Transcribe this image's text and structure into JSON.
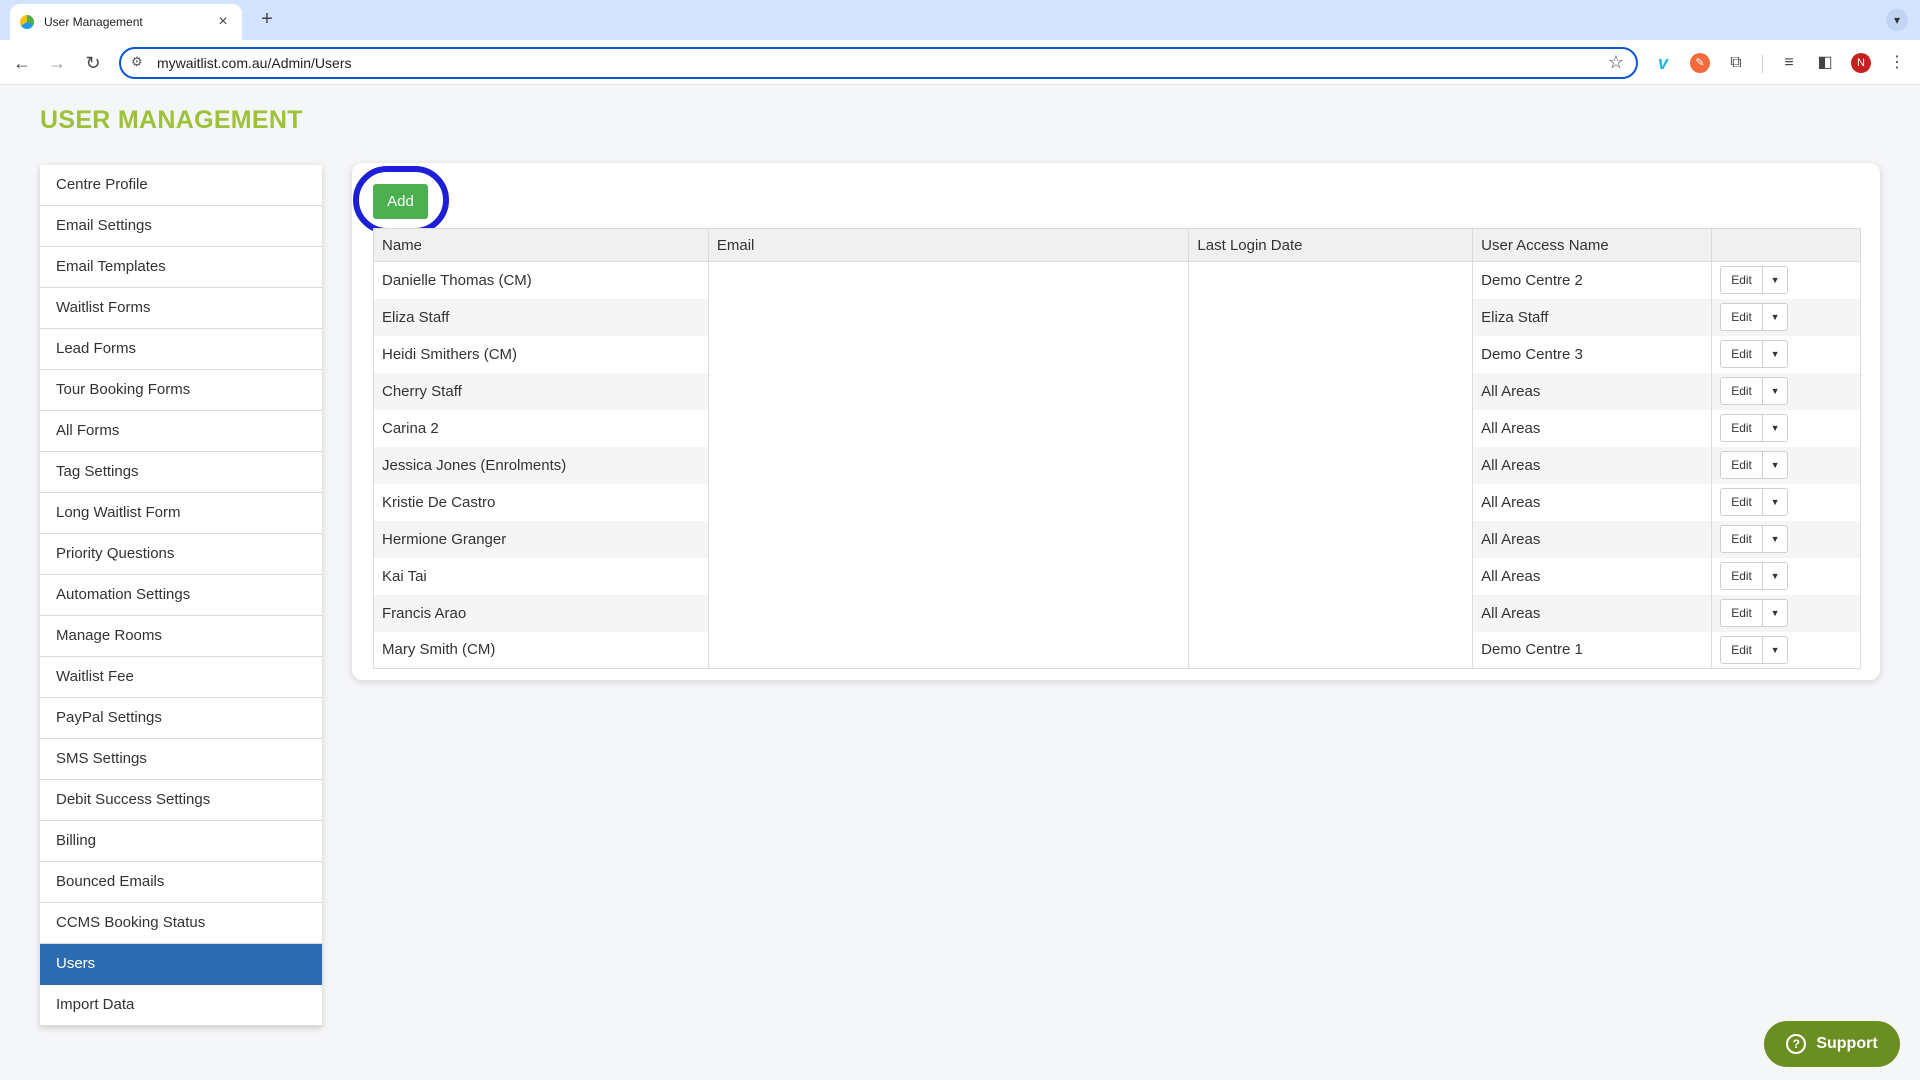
{
  "browser": {
    "tab_title": "User Management",
    "tab_close": "×",
    "new_tab": "+",
    "url": "mywaitlist.com.au/Admin/Users",
    "profile_initial": "N"
  },
  "page": {
    "title": "USER MANAGEMENT",
    "add_label": "Add",
    "support_label": "Support"
  },
  "sidebar": {
    "items": [
      {
        "label": "Centre Profile"
      },
      {
        "label": "Email Settings"
      },
      {
        "label": "Email Templates"
      },
      {
        "label": "Waitlist Forms"
      },
      {
        "label": "Lead Forms"
      },
      {
        "label": "Tour Booking Forms"
      },
      {
        "label": "All Forms"
      },
      {
        "label": "Tag Settings"
      },
      {
        "label": "Long Waitlist Form"
      },
      {
        "label": "Priority Questions"
      },
      {
        "label": "Automation Settings"
      },
      {
        "label": "Manage Rooms"
      },
      {
        "label": "Waitlist Fee"
      },
      {
        "label": "PayPal Settings"
      },
      {
        "label": "SMS Settings"
      },
      {
        "label": "Debit Success Settings"
      },
      {
        "label": "Billing"
      },
      {
        "label": "Bounced Emails"
      },
      {
        "label": "CCMS Booking Status"
      },
      {
        "label": "Users"
      },
      {
        "label": "Import Data"
      }
    ],
    "active_index": 19
  },
  "table": {
    "headers": [
      "Name",
      "Email",
      "Last Login Date",
      "User Access Name",
      ""
    ],
    "edit_label": "Edit",
    "rows": [
      {
        "name": "Danielle Thomas (CM)",
        "email": "",
        "last_login": "",
        "access": "Demo Centre 2"
      },
      {
        "name": "Eliza Staff",
        "email": "",
        "last_login": "",
        "access": "Eliza Staff"
      },
      {
        "name": "Heidi Smithers (CM)",
        "email": "",
        "last_login": "",
        "access": "Demo Centre 3"
      },
      {
        "name": "Cherry Staff",
        "email": "",
        "last_login": "",
        "access": "All Areas"
      },
      {
        "name": "Carina 2",
        "email": "",
        "last_login": "",
        "access": "All Areas"
      },
      {
        "name": "Jessica Jones (Enrolments)",
        "email": "",
        "last_login": "",
        "access": "All Areas"
      },
      {
        "name": "Kristie De Castro",
        "email": "",
        "last_login": "",
        "access": "All Areas"
      },
      {
        "name": "Hermione Granger",
        "email": "",
        "last_login": "",
        "access": "All Areas"
      },
      {
        "name": "Kai Tai",
        "email": "",
        "last_login": "",
        "access": "All Areas"
      },
      {
        "name": "Francis Arao",
        "email": "",
        "last_login": "",
        "access": "All Areas"
      },
      {
        "name": "Mary Smith (CM)",
        "email": "",
        "last_login": "",
        "access": "Demo Centre 1"
      }
    ]
  },
  "colors": {
    "title_green": "#9ec13a",
    "active_blue": "#2d6cb0",
    "add_green": "#4caf50",
    "highlight_ring": "#1d1fd6",
    "support_green": "#6b8e23"
  }
}
